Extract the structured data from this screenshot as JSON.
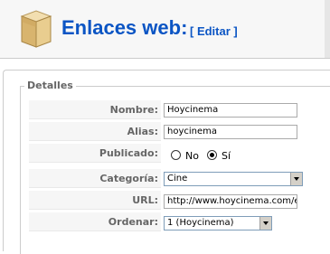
{
  "header": {
    "title": "Enlaces web:",
    "edit_link": "[ Editar ]",
    "icon": "box-icon"
  },
  "details": {
    "legend": "Detalles",
    "fields": {
      "nombre": {
        "label": "Nombre:",
        "value": "Hoycinema"
      },
      "alias": {
        "label": "Alias:",
        "value": "hoycinema"
      },
      "publicado": {
        "label": "Publicado:",
        "options": [
          "No",
          "Sí"
        ],
        "selected": "Sí"
      },
      "categoria": {
        "label": "Categoría:",
        "value": "Cine"
      },
      "url": {
        "label": "URL:",
        "value": "http://www.hoycinema.com/esp"
      },
      "ordenar": {
        "label": "Ordenar:",
        "value": "1 (Hoycinema)"
      }
    }
  },
  "colors": {
    "title_blue": "#0b55c4",
    "label_bg": "#f6f6f6",
    "label_text": "#666666"
  }
}
